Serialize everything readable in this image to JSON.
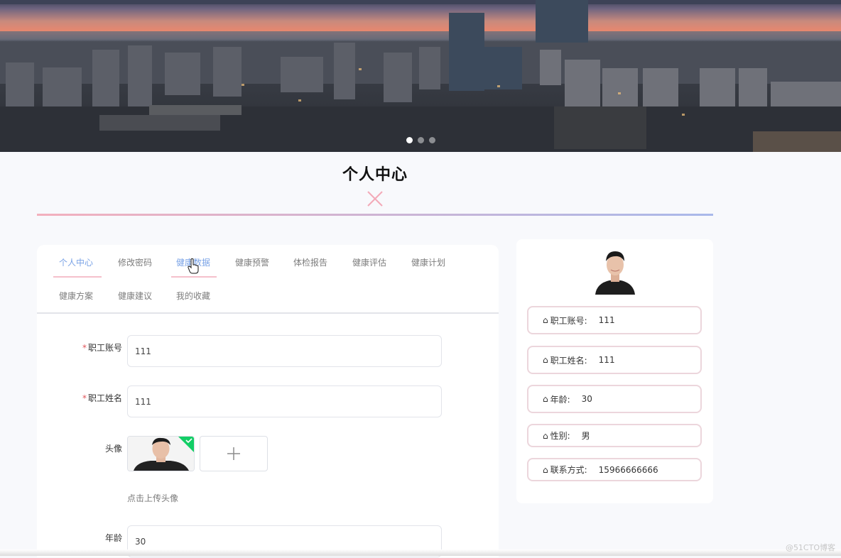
{
  "page": {
    "title": "个人中心",
    "watermark": "@51CTO博客"
  },
  "banner": {
    "carousel_dots": 3,
    "active_dot": 0
  },
  "tabs": [
    {
      "label": "个人中心",
      "active": true
    },
    {
      "label": "修改密码",
      "active": false
    },
    {
      "label": "健康数据",
      "active": false,
      "hover": true
    },
    {
      "label": "健康预警",
      "active": false
    },
    {
      "label": "体检报告",
      "active": false
    },
    {
      "label": "健康评估",
      "active": false
    },
    {
      "label": "健康计划",
      "active": false
    },
    {
      "label": "健康方案",
      "active": false
    },
    {
      "label": "健康建议",
      "active": false
    },
    {
      "label": "我的收藏",
      "active": false
    }
  ],
  "form": {
    "employee_no": {
      "label": "职工账号",
      "required": true,
      "value": "111"
    },
    "employee_name": {
      "label": "职工姓名",
      "required": true,
      "value": "111"
    },
    "avatar": {
      "label": "头像",
      "upload_hint": "点击上传头像"
    },
    "age": {
      "label": "年龄",
      "value": "30"
    }
  },
  "profile": {
    "rows": [
      {
        "label": "职工账号:",
        "value": "111"
      },
      {
        "label": "职工姓名:",
        "value": "111"
      },
      {
        "label": "年龄:",
        "value": "30"
      },
      {
        "label": "性别:",
        "value": "男"
      },
      {
        "label": "联系方式:",
        "value": "15966666666"
      }
    ]
  },
  "colors": {
    "accent": "#7aa3e6",
    "divider_start": "#f3b0bd",
    "divider_end": "#a9b9ea",
    "row_border": "#ecd6dc",
    "required": "#e0555a",
    "upload_success": "#13ce66"
  }
}
